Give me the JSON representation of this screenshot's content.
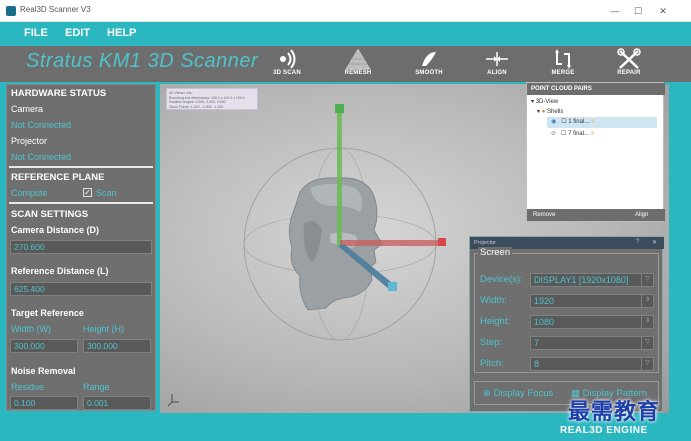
{
  "titlebar": {
    "title": "Real3D Scanner V3",
    "minimize": "—",
    "maximize": "☐",
    "close": "✕"
  },
  "menu": {
    "file": "FILE",
    "edit": "EDIT",
    "help": "HELP"
  },
  "toolbar": {
    "brand": "Stratus KM1 3D Scanner",
    "tools": [
      {
        "label": "3D SCAN",
        "icon": "3d-scan-icon",
        "glyph": "⦁)"
      },
      {
        "label": "REMESH",
        "icon": "remesh-icon",
        "glyph": "▲"
      },
      {
        "label": "SMOOTH",
        "icon": "smooth-icon",
        "glyph": "✎"
      },
      {
        "label": "ALIGN",
        "icon": "align-icon",
        "glyph": "→|←"
      },
      {
        "label": "MERGE",
        "icon": "merge-icon",
        "glyph": "⤶⤷"
      },
      {
        "label": "REPAIR",
        "icon": "repair-icon",
        "glyph": "✂"
      }
    ]
  },
  "left_panel": {
    "hardware_status": "HARDWARE STATUS",
    "camera_label": "Camera",
    "camera_status": "Not Connected",
    "projector_label": "Projector",
    "projector_status": "Not Connected",
    "reference_plane": "REFERENCE PLANE",
    "compute": "Compute",
    "scan": "Scan",
    "scan_checked": "✓",
    "scan_settings": "SCAN SETTINGS",
    "camera_distance_label": "Camera Distance (D)",
    "camera_distance_value": "270.600",
    "reference_distance_label": "Reference Distance (L)",
    "reference_distance_value": "625.400",
    "target_reference": "Target Reference",
    "width_label": "Width (W)",
    "height_label": "Height (H)",
    "width_value": "300.000",
    "height_value": "300.000",
    "noise_removal": "Noise Removal",
    "residue_label": "Residue",
    "range_label": "Range",
    "residue_value": "0.100",
    "range_value": "0.001"
  },
  "viewport": {
    "info_lines": [
      "3D Viewer info:",
      "Bounding box dimensions: 100.0 x 100.0 x 100.0",
      "Rotation Angles: 0.000, 0.000, 0.000",
      "Cloud Points: 1,000 - 1,000 - 1,000"
    ]
  },
  "point_cloud": {
    "title": "POINT CLOUD PAIRS",
    "root": "3D-View",
    "shells": "Shells",
    "item1": "1 final...",
    "item2": "7 final...",
    "remove": "Remove",
    "align": "Align"
  },
  "projector": {
    "title": "Projector",
    "help": "?",
    "close": "✕",
    "screen": "Screen",
    "devices_label": "Device(s):",
    "devices_value": "DISPLAY1 [1920x1080]",
    "width_label": "Width:",
    "width_value": "1920",
    "height_label": "Height:",
    "height_value": "1080",
    "step_label": "Step:",
    "step_value": "7",
    "pitch_label": "Pitch:",
    "pitch_value": "8",
    "display_focus": "Display Focus",
    "display_pattern": "Display Pattern"
  },
  "footer": {
    "engine": "REAL3D ENGINE"
  },
  "watermark": "最需教育",
  "colors": {
    "accent": "#2bb7c0",
    "panel": "#6f6f6f",
    "status": "#4fc3cc"
  }
}
